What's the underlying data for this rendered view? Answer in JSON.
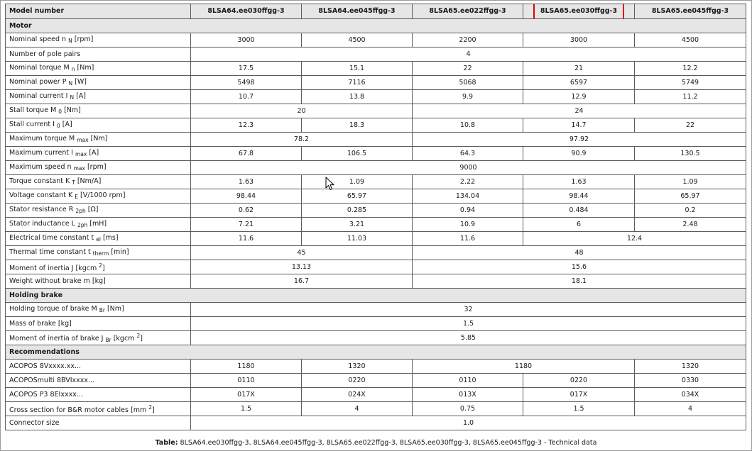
{
  "table": {
    "header": {
      "first": "Model number",
      "models": [
        "8LSA64.ee030ffgg-3",
        "8LSA64.ee045ffgg-3",
        "8LSA65.ee022ffgg-3",
        "8LSA65.ee030ffgg-3",
        "8LSA65.ee045ffgg-3"
      ],
      "highlighted_model_index": 3,
      "highlight_color": "#e00000"
    },
    "sections": {
      "motor": "Motor",
      "holding_brake": "Holding brake",
      "recommendations": "Recommendations"
    },
    "motor": {
      "nominal_speed": {
        "label": "Nominal speed n",
        "sub": "N",
        "unit": " [rpm]",
        "values": [
          "3000",
          "4500",
          "2200",
          "3000",
          "4500"
        ]
      },
      "pole_pairs": {
        "label": "Number of pole pairs",
        "value": "4"
      },
      "nominal_torque": {
        "label": "Nominal torque M",
        "sub": "n",
        "unit": " [Nm]",
        "values": [
          "17.5",
          "15.1",
          "22",
          "21",
          "12.2"
        ]
      },
      "nominal_power": {
        "label": "Nominal power P",
        "sub": "N",
        "unit": " [W]",
        "values": [
          "5498",
          "7116",
          "5068",
          "6597",
          "5749"
        ]
      },
      "nominal_current": {
        "label": "Nominal current I",
        "sub": "N",
        "unit": " [A]",
        "values": [
          "10.7",
          "13.8",
          "9.9",
          "12.9",
          "11.2"
        ]
      },
      "stall_torque": {
        "label": "Stall torque M",
        "sub": "0",
        "unit": " [Nm]",
        "values": [
          "20",
          "24"
        ]
      },
      "stall_current": {
        "label": "Stall current I",
        "sub": "0",
        "unit": " [A]",
        "values": [
          "12.3",
          "18.3",
          "10.8",
          "14.7",
          "22"
        ]
      },
      "max_torque": {
        "label": "Maximum torque M",
        "sub": "max",
        "unit": " [Nm]",
        "values": [
          "78.2",
          "97.92"
        ]
      },
      "max_current": {
        "label": "Maximum current I",
        "sub": "max",
        "unit": " [A]",
        "values": [
          "67.8",
          "106.5",
          "64.3",
          "90.9",
          "130.5"
        ]
      },
      "max_speed": {
        "label": "Maximum speed n",
        "sub": "max",
        "unit": " [rpm]",
        "value": "9000"
      },
      "torque_constant": {
        "label": "Torque constant K",
        "sub": "T",
        "unit": " [Nm/A]",
        "values": [
          "1.63",
          "1.09",
          "2.22",
          "1.63",
          "1.09"
        ]
      },
      "voltage_constant": {
        "label": "Voltage constant K",
        "sub": "E",
        "unit": " [V/1000 rpm]",
        "values": [
          "98.44",
          "65.97",
          "134.04",
          "98.44",
          "65.97"
        ]
      },
      "stator_resistance": {
        "label": "Stator resistance R",
        "sub": "2ph",
        "unit": " [Ω]",
        "values": [
          "0.62",
          "0.285",
          "0.94",
          "0.484",
          "0.2"
        ]
      },
      "stator_inductance": {
        "label": "Stator inductance L",
        "sub": "2ph",
        "unit": " [mH]",
        "values": [
          "7.21",
          "3.21",
          "10.9",
          "6",
          "2.48"
        ]
      },
      "electrical_time_constant": {
        "label": "Electrical time constant t",
        "sub": "el",
        "unit": " [ms]",
        "values": [
          "11.6",
          "11.03",
          "11.6",
          "12.4"
        ]
      },
      "thermal_time_constant": {
        "label": "Thermal time constant t",
        "sub": "therm",
        "unit": " [min]",
        "values": [
          "45",
          "48"
        ]
      },
      "moment_of_inertia": {
        "label": "Moment of inertia J [kgcm",
        "sup": "2",
        "unit": "]",
        "values": [
          "13.13",
          "15.6"
        ]
      },
      "weight": {
        "label": "Weight without brake m [kg]",
        "values": [
          "16.7",
          "18.1"
        ]
      }
    },
    "brake": {
      "holding_torque": {
        "label": "Holding torque of brake M",
        "sub": "Br",
        "unit": " [Nm]",
        "value": "32"
      },
      "mass": {
        "label": "Mass of brake [kg]",
        "value": "1.5"
      },
      "inertia": {
        "label": "Moment of inertia of brake J",
        "sub": "Br",
        "unit": " [kgcm",
        "sup": "2",
        "unit_end": "]",
        "value": "5.85"
      }
    },
    "recommendations": {
      "acopos": {
        "label": "ACOPOS 8Vxxxx.xx...",
        "values": [
          "1180",
          "1320",
          "1180",
          "1320"
        ]
      },
      "acoposmulti": {
        "label": "ACOPOSmulti 8BVIxxxx...",
        "values": [
          "0110",
          "0220",
          "0110",
          "0220",
          "0330"
        ]
      },
      "acopos_p3": {
        "label": "ACOPOS P3 8EIxxxx...",
        "values": [
          "017X",
          "024X",
          "013X",
          "017X",
          "034X"
        ]
      },
      "cross_section": {
        "label": "Cross section for B&R motor cables [mm",
        "sup": "2",
        "unit": "]",
        "values": [
          "1.5",
          "4",
          "0.75",
          "1.5",
          "4"
        ]
      },
      "connector_size": {
        "label": "Connector size",
        "value": "1.0"
      }
    }
  },
  "caption": {
    "prefix": "Table:",
    "text": " 8LSA64.ee030ffgg-3, 8LSA64.ee045ffgg-3, 8LSA65.ee022ffgg-3, 8LSA65.ee030ffgg-3, 8LSA65.ee045ffgg-3 - Technical data"
  },
  "cursor_icon": "arrow-cursor-icon"
}
